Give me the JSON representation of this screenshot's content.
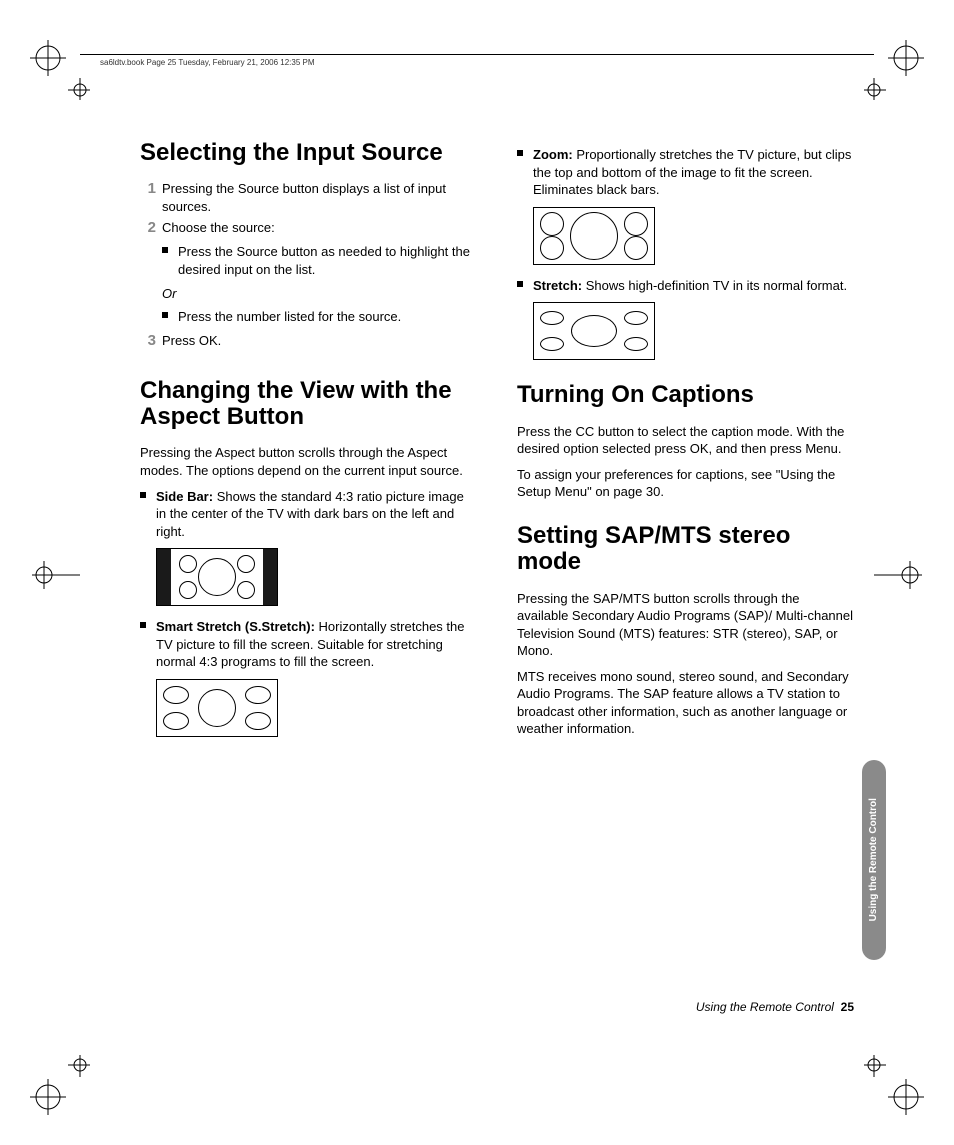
{
  "header_text": "sa6ldtv.book  Page 25  Tuesday, February 21, 2006  12:35 PM",
  "left": {
    "h1_a": "Selecting the Input Source",
    "steps": [
      "Pressing the Source button displays a list of input sources.",
      "Choose the source:"
    ],
    "sub_bullets": [
      "Press the Source button as needed to highlight the desired input on the list.",
      "Press the number listed for the source."
    ],
    "or": "Or",
    "step3": "Press OK.",
    "h1_b": "Changing the View with the Aspect Button",
    "aspect_intro": "Pressing the Aspect button scrolls through the Aspect modes. The options depend on the current input source.",
    "sidebar_label": "Side Bar:",
    "sidebar_text": " Shows the standard 4:3 ratio picture image in the center of the TV with dark bars on the left and right.",
    "sstretch_label": "Smart Stretch (S.Stretch):",
    "sstretch_text": " Horizontally stretches the TV picture to fill the screen. Suitable for stretching normal 4:3 programs to fill the screen."
  },
  "right": {
    "zoom_label": "Zoom:",
    "zoom_text": " Proportionally stretches the TV picture, but clips the top and bottom of the image to fit the screen. Eliminates black bars.",
    "stretch_label": "Stretch:",
    "stretch_text": " Shows high-definition TV in its normal format.",
    "h1_c": "Turning On Captions",
    "cap_p1": "Press the CC button to select the caption mode. With the desired option selected press OK, and then press Menu.",
    "cap_p2": "To assign your preferences for captions, see \"Using the Setup Menu\" on page 30.",
    "h1_d": "Setting SAP/MTS stereo mode",
    "sap_p1": "Pressing the SAP/MTS button scrolls through the available Secondary Audio Programs (SAP)/ Multi-channel Television Sound (MTS) features: STR (stereo), SAP, or Mono.",
    "sap_p2": "MTS receives mono sound, stereo sound, and Secondary Audio Programs. The SAP feature allows a TV station to broadcast other information, such as another language or weather information."
  },
  "footer_section": "Using the Remote Control",
  "footer_page": "25",
  "side_tab": "Using the Remote Control"
}
